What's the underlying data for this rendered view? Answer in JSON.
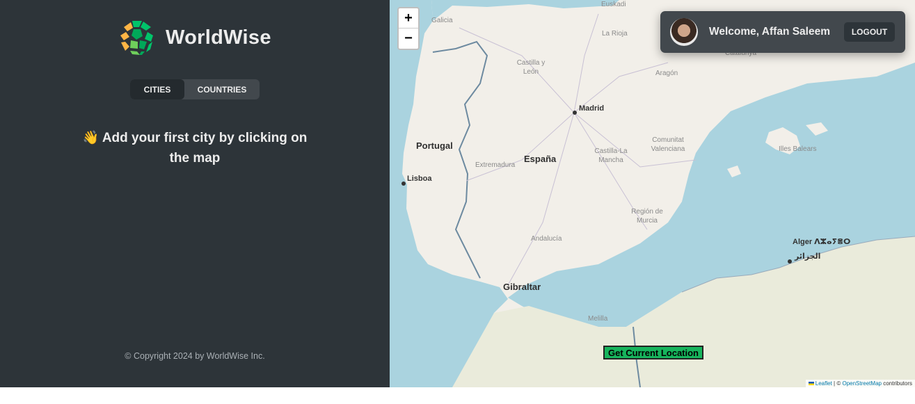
{
  "app": {
    "name": "WorldWise",
    "colors": {
      "sidebar_bg": "#2d3439",
      "panel_bg": "#42484d",
      "brand_green": "#16b45c",
      "brand_orange": "#ffb545"
    }
  },
  "sidebar": {
    "tabs": [
      {
        "label": "CITIES",
        "active": true
      },
      {
        "label": "COUNTRIES",
        "active": false
      }
    ],
    "empty_message": "👋 Add your first city by clicking on the map",
    "footer": "© Copyright 2024 by WorldWise Inc."
  },
  "map": {
    "zoom_in": "+",
    "zoom_out": "−",
    "labels": {
      "euskadi": "Euskadi",
      "galicia": "Galicia",
      "la_rioja": "La Rioja",
      "castilla_leon": "Castilla y León",
      "aragon": "Aragón",
      "catalunya": "Catalunya",
      "madrid": "Madrid",
      "portugal": "Portugal",
      "espana": "España",
      "extremadura": "Extremadura",
      "castilla_mancha": "Castilla-La Mancha",
      "valenciana": "Comunitat Valenciana",
      "illes_balears": "Illes Balears",
      "lisboa": "Lisboa",
      "murcia": "Región de Murcia",
      "andalucia": "Andalucía",
      "alger": "Alger ⴷⵣⴰⵢⴻⵔ",
      "aljazair": "الجزائر",
      "gibraltar": "Gibraltar",
      "melilla": "Melilla"
    },
    "geolocation_button": "Get Current Location",
    "attribution": {
      "leaflet": "Leaflet",
      "separator": "| ©",
      "osm": "OpenStreetMap",
      "contributors": "contributors"
    }
  },
  "user": {
    "welcome": "Welcome, Affan Saleem",
    "logout_label": "LOGOUT"
  }
}
